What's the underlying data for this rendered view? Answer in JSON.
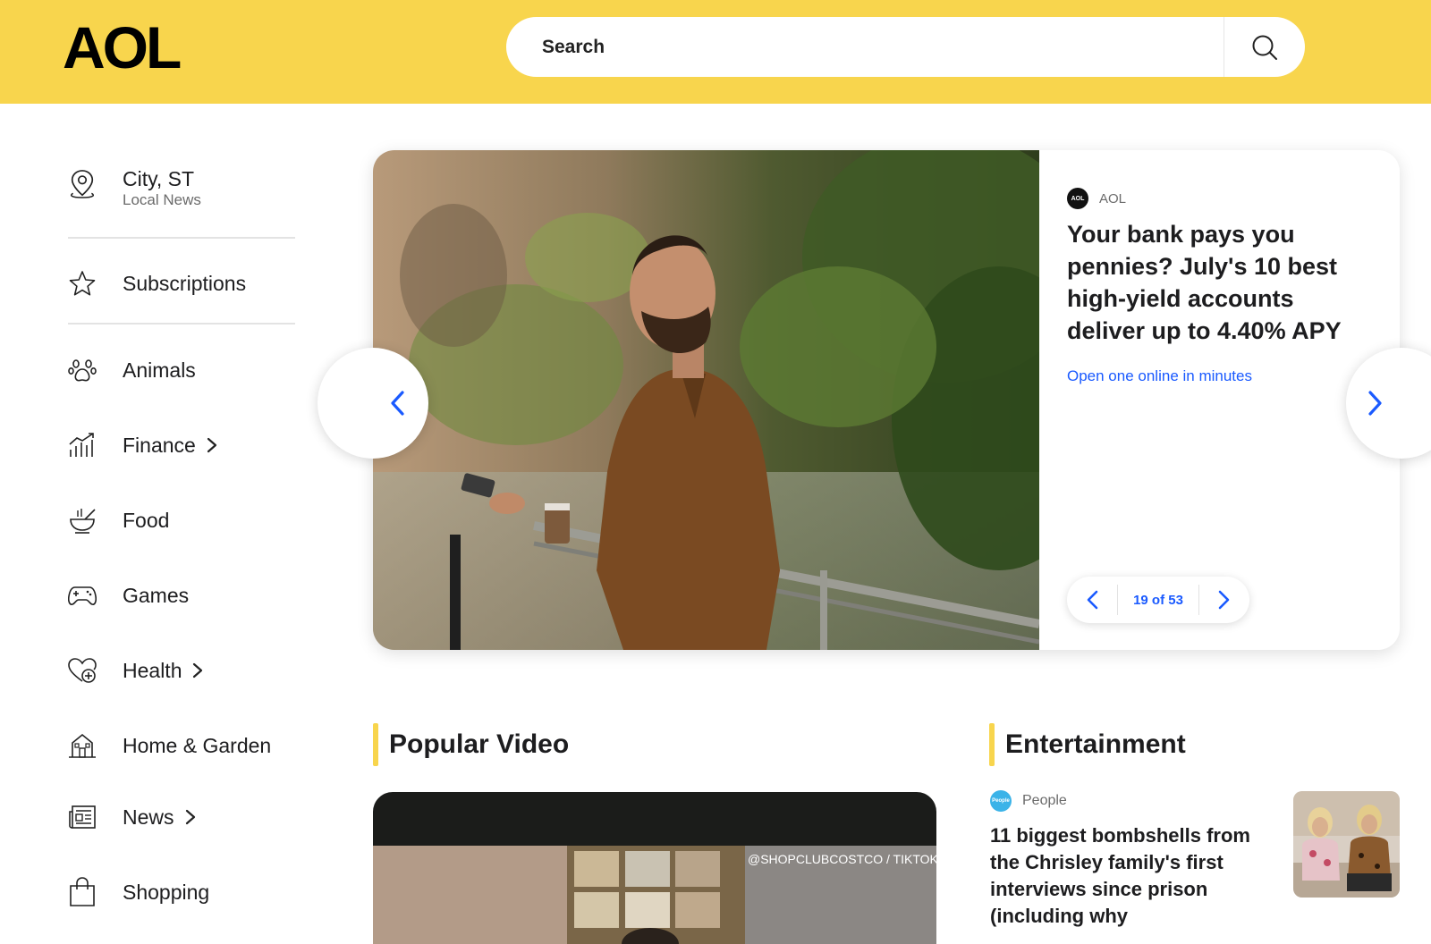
{
  "header": {
    "logo_text": "AOL",
    "search_placeholder": "Search",
    "brand_color": "#f8d54d"
  },
  "sidebar": {
    "location": {
      "city": "City, ST",
      "subtitle": "Local News",
      "icon": "location-pin-icon"
    },
    "subscriptions": {
      "label": "Subscriptions",
      "icon": "star-icon"
    },
    "items": [
      {
        "label": "Animals",
        "icon": "paw-icon",
        "has_submenu": false
      },
      {
        "label": "Finance",
        "icon": "chart-icon",
        "has_submenu": true
      },
      {
        "label": "Food",
        "icon": "bowl-icon",
        "has_submenu": false
      },
      {
        "label": "Games",
        "icon": "gamepad-icon",
        "has_submenu": false
      },
      {
        "label": "Health",
        "icon": "heart-plus-icon",
        "has_submenu": true
      },
      {
        "label": "Home & Garden",
        "icon": "house-icon",
        "has_submenu": false
      },
      {
        "label": "News",
        "icon": "newspaper-icon",
        "has_submenu": true
      },
      {
        "label": "Shopping",
        "icon": "bag-icon",
        "has_submenu": false
      }
    ]
  },
  "hero": {
    "source": "AOL",
    "source_badge": "AOL",
    "title": "Your bank pays you pennies? July's 10 best high-yield accounts deliver up to 4.40% APY",
    "cta": "Open one online in minutes",
    "pager": "19 of 53",
    "link_color": "#1a5aff"
  },
  "popular_video": {
    "title": "Popular Video",
    "credit": "@SHOPCLUBCOSTCO / TIKTOK"
  },
  "entertainment": {
    "title": "Entertainment",
    "source": "People",
    "source_badge": "People",
    "headline": "11 biggest bombshells from the Chrisley family's first interviews since prison (including why"
  }
}
